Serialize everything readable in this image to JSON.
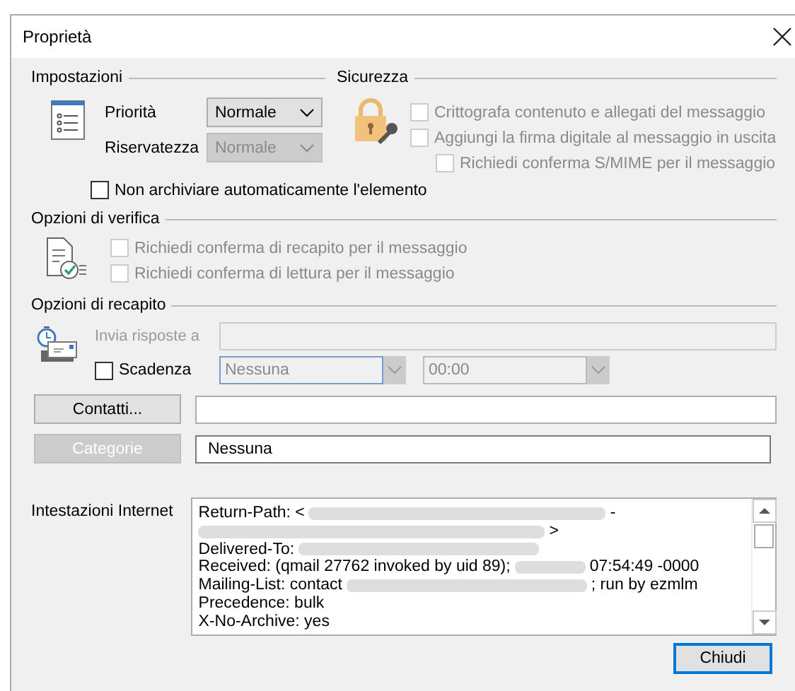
{
  "window": {
    "title": "Proprietà"
  },
  "settings": {
    "title": "Impostazioni",
    "fields": [
      {
        "label": "Priorità",
        "value": "Normale",
        "disabled": false
      },
      {
        "label": "Riservatezza",
        "value": "Normale",
        "disabled": true
      }
    ],
    "no_autoarchive": {
      "label": "Non archiviare automaticamente l'elemento",
      "checked": false
    }
  },
  "security": {
    "title": "Sicurezza",
    "options": [
      {
        "label": "Crittografa contenuto e allegati del messaggio",
        "checked": false,
        "disabled": true
      },
      {
        "label": "Aggiungi la firma digitale al messaggio in uscita",
        "checked": false,
        "disabled": true,
        "children": [
          {
            "label": "Richiedi conferma S/MIME per il messaggio",
            "checked": false,
            "disabled": true
          }
        ]
      }
    ]
  },
  "tracking": {
    "title": "Opzioni di verifica",
    "options": [
      {
        "label": "Richiedi conferma di recapito per il messaggio",
        "checked": false,
        "disabled": true
      },
      {
        "label": "Richiedi conferma di lettura per il messaggio",
        "checked": false,
        "disabled": true
      }
    ]
  },
  "delivery": {
    "title": "Opzioni di recapito",
    "reply_to": {
      "label": "Invia risposte a",
      "disabled": true
    },
    "expires": {
      "label": "Scadenza",
      "checked": false,
      "date": "Nessuna",
      "time": "00:00",
      "disabled": true
    }
  },
  "contacts": {
    "label": "Contatti...",
    "disabled": false
  },
  "categories": {
    "label": "Categorie",
    "disabled": true,
    "value": "Nessuna"
  },
  "headers": {
    "label": "Intestazioni Internet",
    "lines": [
      {
        "segments": [
          {
            "kind": "text",
            "text": "Return-Path: <"
          },
          {
            "kind": "redacted"
          },
          {
            "kind": "text",
            "text": "-"
          }
        ]
      },
      {
        "segments": [
          {
            "kind": "redacted"
          },
          {
            "kind": "text",
            "text": ">"
          }
        ]
      },
      {
        "segments": [
          {
            "kind": "text",
            "text": "Delivered-To:"
          },
          {
            "kind": "redacted"
          }
        ]
      },
      {
        "segments": [
          {
            "kind": "text",
            "text": "Received: (qmail 27762 invoked by uid 89);"
          },
          {
            "kind": "redacted"
          },
          {
            "kind": "text",
            "text": "07:54:49 -0000"
          }
        ]
      },
      {
        "segments": [
          {
            "kind": "text",
            "text": "Mailing-List: contact"
          },
          {
            "kind": "redacted"
          },
          {
            "kind": "text",
            "text": "; run by ezmlm"
          }
        ]
      },
      {
        "segments": [
          {
            "kind": "text",
            "text": "Precedence: bulk"
          }
        ]
      },
      {
        "segments": [
          {
            "kind": "text",
            "text": "X-No-Archive: yes"
          }
        ]
      }
    ]
  },
  "buttons": [
    {
      "label": "Chiudi",
      "default": true
    }
  ]
}
